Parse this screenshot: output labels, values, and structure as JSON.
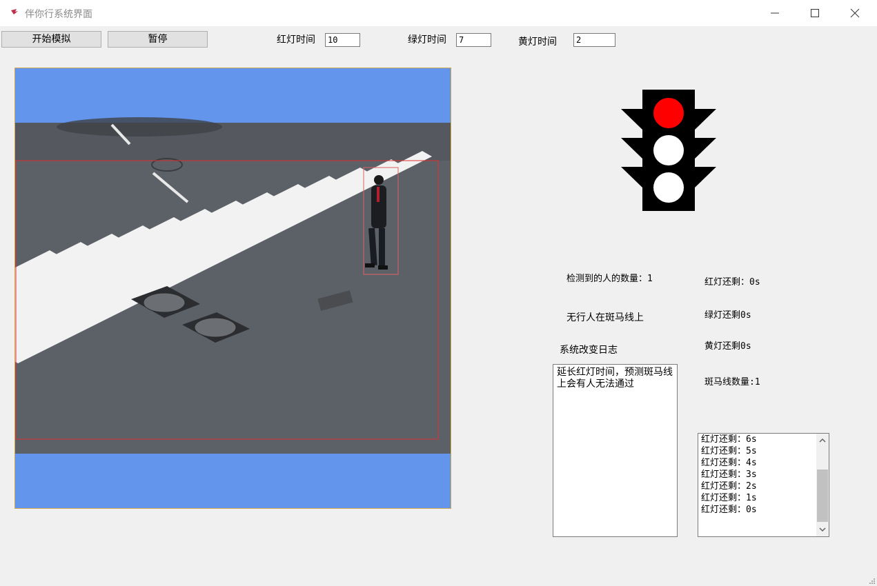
{
  "window": {
    "title": "伴你行系统界面"
  },
  "toolbar": {
    "start_label": "开始模拟",
    "pause_label": "暂停",
    "red_time_label": "红灯时间",
    "red_time_value": "10",
    "green_time_label": "绿灯时间",
    "green_time_value": "7",
    "yellow_time_label": "黄灯时间",
    "yellow_time_value": "2"
  },
  "traffic_light": {
    "active": "red",
    "colors": {
      "red": "#ff0000",
      "off": "#ffffff",
      "housing": "#000000"
    }
  },
  "status": {
    "people_detected": "检测到的人的数量：1",
    "crosswalk_state": "无行人在斑马线上",
    "log_label": "系统改变日志",
    "red_remaining": "红灯还剩：0s",
    "green_remaining": "绿灯还剩0s",
    "yellow_remaining": "黄灯还剩0s",
    "crosswalk_count": "斑马线数量:1"
  },
  "log": {
    "text": "延长红灯时间，预测斑马线上会有人无法通过"
  },
  "countdown_list": [
    "红灯还剩：6s",
    "红灯还剩：5s",
    "红灯还剩：4s",
    "红灯还剩：3s",
    "红灯还剩：2s",
    "红灯还剩：1s",
    "红灯还剩：0s"
  ],
  "video": {
    "letterbox_color": "#6495ed",
    "box_color": "#e03030"
  }
}
